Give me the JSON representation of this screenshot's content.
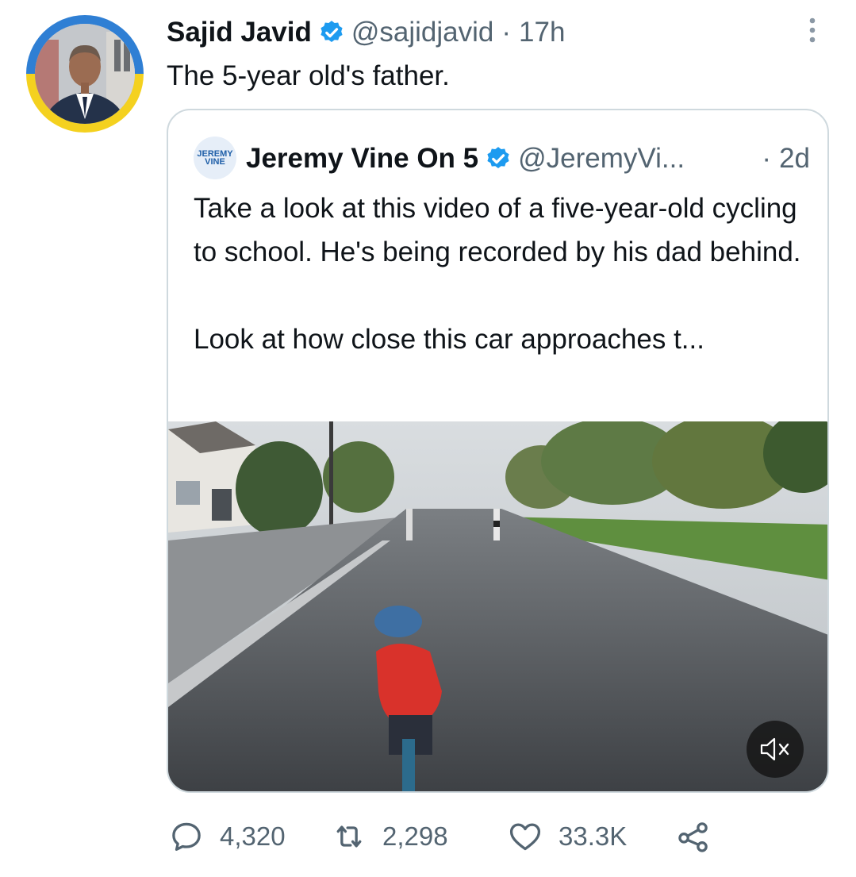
{
  "tweet": {
    "author_name": "Sajid Javid",
    "author_handle": "@sajidjavid",
    "separator": "·",
    "time": "17h",
    "text": "The 5-year old's father.",
    "avatar_ring_colors": [
      "#2f7fd4",
      "#f4d11f"
    ]
  },
  "quote": {
    "avatar_text": "JEREMY VINE",
    "author_name": "Jeremy Vine On 5",
    "author_handle": "@JeremyVi...",
    "separator": "·",
    "time": "2d",
    "text_para1": "Take a look at this video of a five-year-old cycling to school. He's being recorded by his dad behind.",
    "text_para2": "Look at how close this car approaches t...",
    "media": {
      "type": "video",
      "muted": true,
      "mute_icon": "volume-mute-icon"
    }
  },
  "actions": {
    "replies": "4,320",
    "retweets": "2,298",
    "likes": "33.3K",
    "share_icon": "share-icon"
  },
  "colors": {
    "verified": "#1d9bf0",
    "secondary_text": "#536471",
    "border": "#cfd9de"
  }
}
